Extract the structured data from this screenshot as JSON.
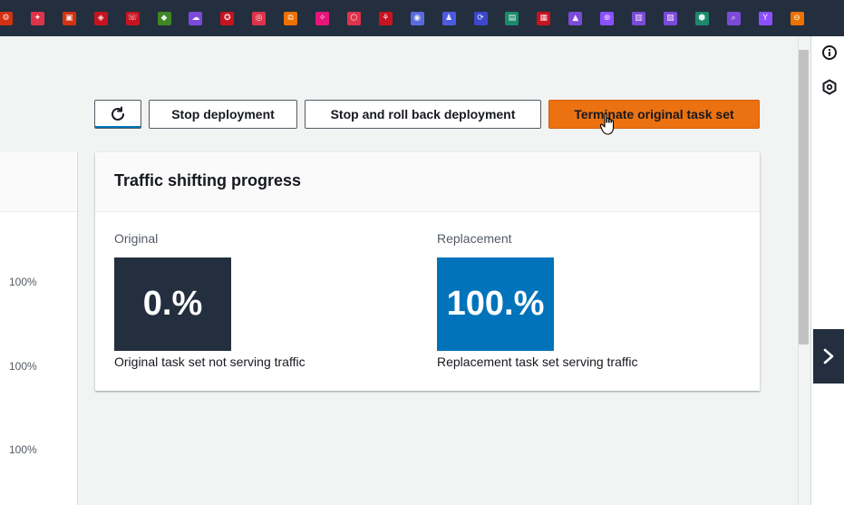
{
  "topbar": {
    "icons": [
      {
        "name": "robomaker-icon",
        "color": "#d13212",
        "glyph": "⚙"
      },
      {
        "name": "pinpoint-icon",
        "color": "#dd344c",
        "glyph": "✦"
      },
      {
        "name": "sagemaker-icon",
        "color": "#d13212",
        "glyph": "▣"
      },
      {
        "name": "iot-icon",
        "color": "#c7131f",
        "glyph": "◈"
      },
      {
        "name": "connect-icon",
        "color": "#c7131f",
        "glyph": "☏"
      },
      {
        "name": "guardduty-icon",
        "color": "#3f8624",
        "glyph": "◆"
      },
      {
        "name": "cloudwatch-icon",
        "color": "#7b4ad8",
        "glyph": "☁"
      },
      {
        "name": "waf-icon",
        "color": "#c7131f",
        "glyph": "✪"
      },
      {
        "name": "chime-icon",
        "color": "#dd344c",
        "glyph": "◎"
      },
      {
        "name": "step-functions-icon",
        "color": "#ed7100",
        "glyph": "⧉"
      },
      {
        "name": "eventbridge-icon",
        "color": "#e7157b",
        "glyph": "✧"
      },
      {
        "name": "config-icon",
        "color": "#dd344c",
        "glyph": "⬡"
      },
      {
        "name": "organizations-icon",
        "color": "#c7131f",
        "glyph": "⚘"
      },
      {
        "name": "route53-icon",
        "color": "#5a6be0",
        "glyph": "◉"
      },
      {
        "name": "iam-icon",
        "color": "#4d5ae0",
        "glyph": "♟"
      },
      {
        "name": "service-catalog-icon",
        "color": "#3b48cc",
        "glyph": "⟳"
      },
      {
        "name": "storage-gateway-icon",
        "color": "#1b8a6b",
        "glyph": "▤"
      },
      {
        "name": "cloudformation-icon",
        "color": "#c7131f",
        "glyph": "▦"
      },
      {
        "name": "trusted-advisor-icon",
        "color": "#7b4ad8",
        "glyph": "▲"
      },
      {
        "name": "app-mesh-icon",
        "color": "#8c4fff",
        "glyph": "⊛"
      },
      {
        "name": "documentdb-icon",
        "color": "#7b4ad8",
        "glyph": "▥"
      },
      {
        "name": "cost-explorer-icon",
        "color": "#7b4ad8",
        "glyph": "▧"
      },
      {
        "name": "shield-icon",
        "color": "#1b8a6b",
        "glyph": "⬢"
      },
      {
        "name": "inspector-icon",
        "color": "#7b4ad8",
        "glyph": "⌕"
      },
      {
        "name": "glue-icon",
        "color": "#8c4fff",
        "glyph": "Y"
      },
      {
        "name": "lambda-icon",
        "color": "#ed7100",
        "glyph": "⊖"
      }
    ]
  },
  "toolbar": {
    "refresh_label": "",
    "stop_label": "Stop deployment",
    "rollback_label": "Stop and roll back deployment",
    "terminate_label": "Terminate original task set"
  },
  "left_table": {
    "values": [
      "100%",
      "100%",
      "100%"
    ]
  },
  "traffic": {
    "title": "Traffic shifting progress",
    "original": {
      "label": "Original",
      "value": "0.%",
      "caption": "Original task set not serving traffic",
      "color": "#232f3e"
    },
    "replacement": {
      "label": "Replacement",
      "value": "100.%",
      "caption": "Replacement task set serving traffic",
      "color": "#0073bb"
    }
  },
  "rail": {
    "icons": [
      "info-icon",
      "hexagon-icon",
      "chevron-right-icon"
    ]
  }
}
